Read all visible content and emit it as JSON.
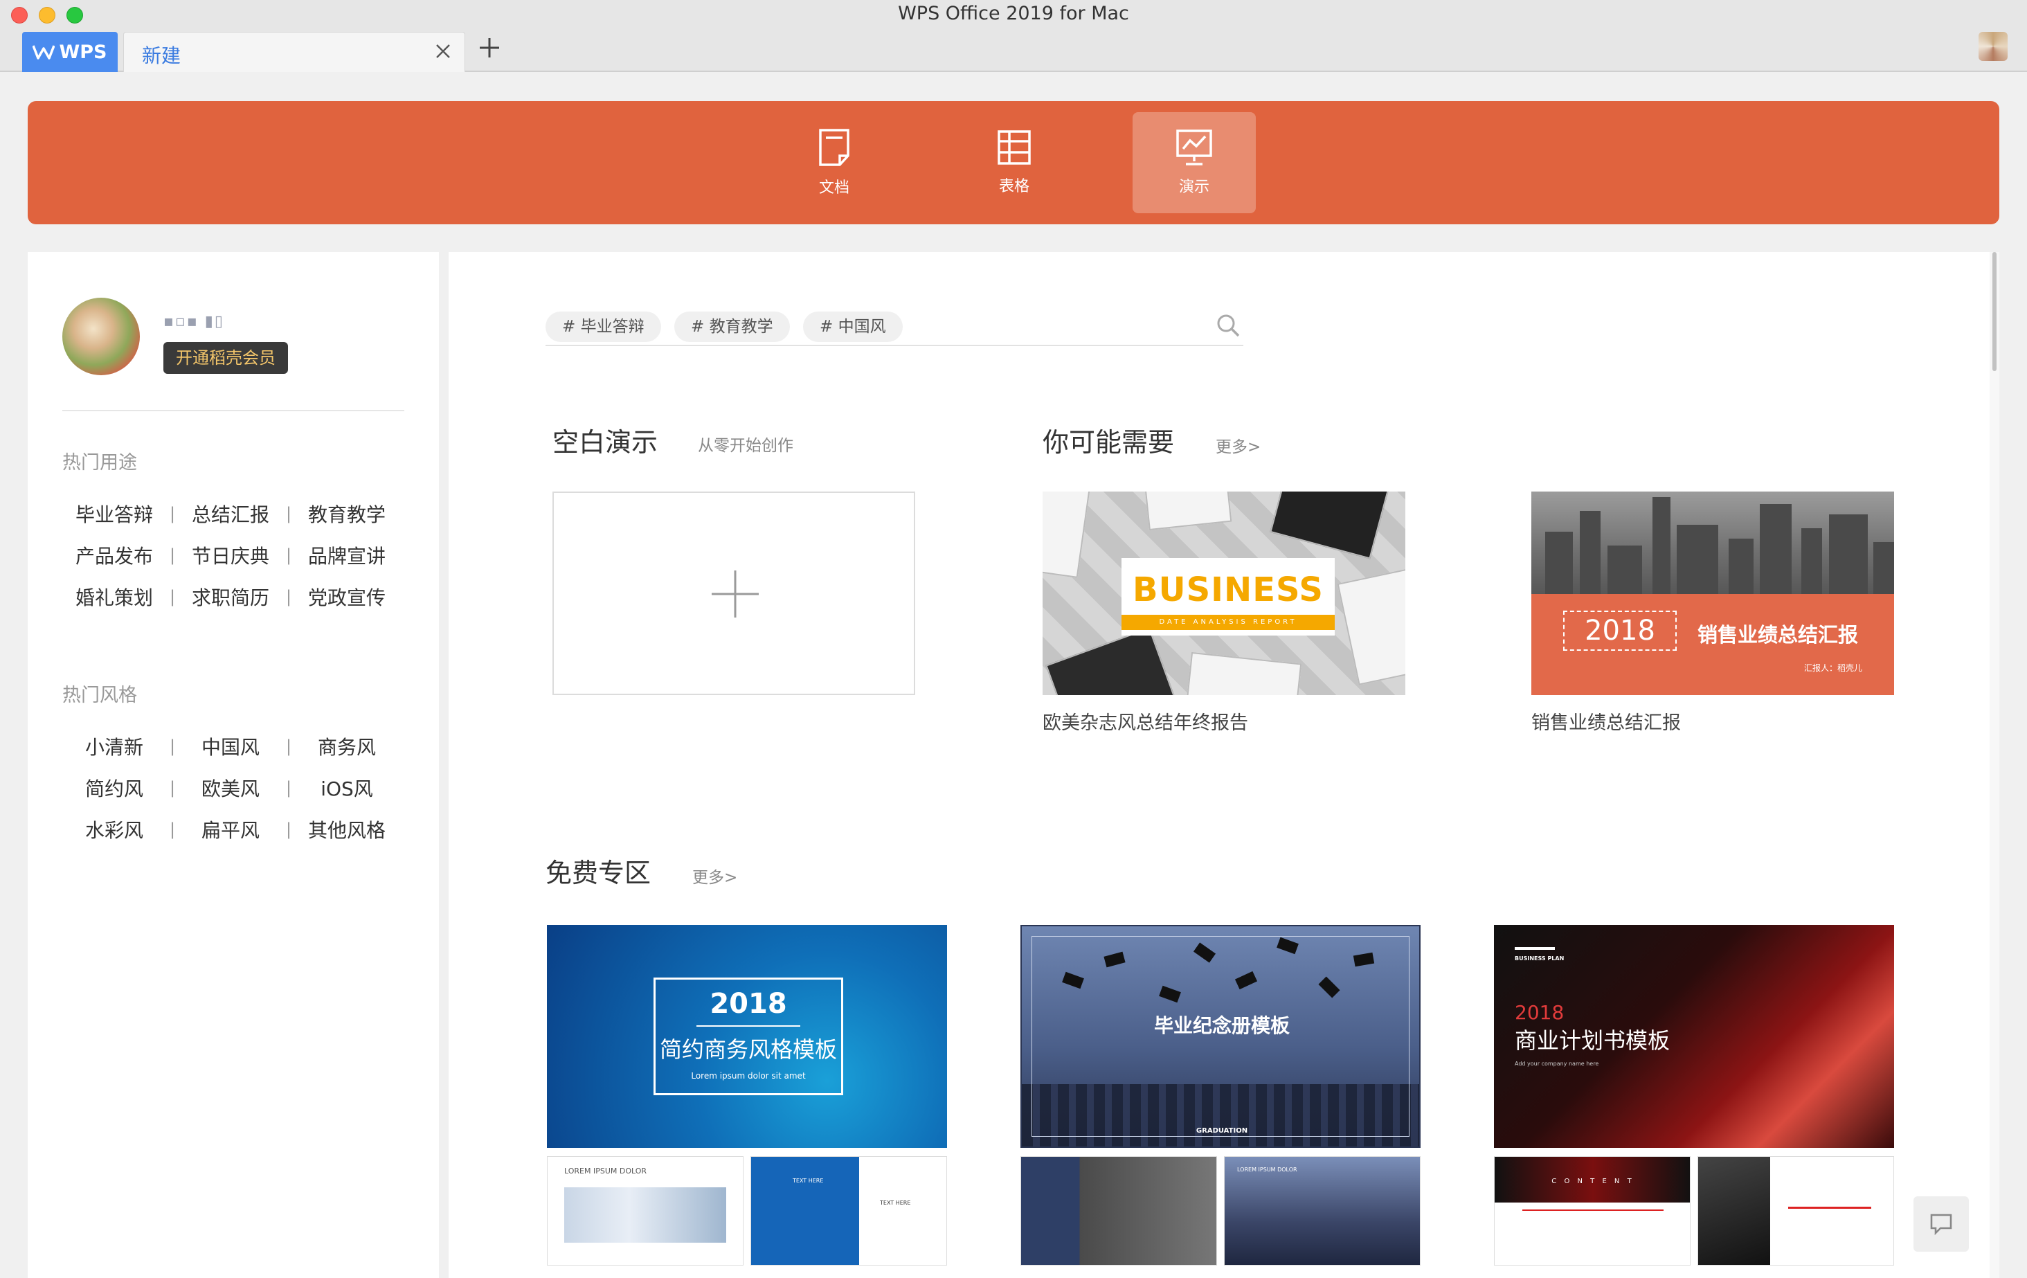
{
  "window": {
    "title": "WPS Office 2019 for Mac",
    "tabs": [
      {
        "label": "WPS"
      },
      {
        "label": "新建"
      }
    ]
  },
  "categories": [
    {
      "label": "文档",
      "icon": "document-icon"
    },
    {
      "label": "表格",
      "icon": "spreadsheet-icon"
    },
    {
      "label": "演示",
      "icon": "presentation-icon",
      "active": true
    }
  ],
  "sidebar": {
    "vip_button": "开通稻壳会员",
    "hot_uses": {
      "title": "热门用途",
      "rows": [
        [
          "毕业答辩",
          "总结汇报",
          "教育教学"
        ],
        [
          "产品发布",
          "节日庆典",
          "品牌宣讲"
        ],
        [
          "婚礼策划",
          "求职简历",
          "党政宣传"
        ]
      ]
    },
    "hot_styles": {
      "title": "热门风格",
      "rows": [
        [
          "小清新",
          "中国风",
          "商务风"
        ],
        [
          "简约风",
          "欧美风",
          "iOS风"
        ],
        [
          "水彩风",
          "扁平风",
          "其他风格"
        ]
      ]
    },
    "separator": "|"
  },
  "search": {
    "tags": [
      "# 毕业答辩",
      "# 教育教学",
      "# 中国风"
    ]
  },
  "blank_section": {
    "title": "空白演示",
    "subtitle": "从零开始创作"
  },
  "need_section": {
    "title": "你可能需要",
    "more": "更多>",
    "templates": [
      {
        "caption": "欧美杂志风总结年终报告",
        "cover_title": "BUSINESS",
        "cover_sub": "DATE ANALYSIS REPORT"
      },
      {
        "caption": "销售业绩总结汇报",
        "cover_year": "2018",
        "cover_title": "销售业绩总结汇报",
        "cover_reporter": "汇报人：稻壳儿"
      }
    ]
  },
  "free_section": {
    "title": "免费专区",
    "more": "更多>",
    "templates": [
      {
        "year": "2018",
        "name": "简约商务风格模板",
        "sub": "Lorem ipsum dolor sit amet",
        "thumb_a": "LOREM IPSUM DOLOR",
        "thumb_b": "TEXT HERE"
      },
      {
        "name": "毕业纪念册模板",
        "foot": "GRADUATION",
        "thumb_b": "LOREM IPSUM DOLOR"
      },
      {
        "tag": "BUSINESS PLAN",
        "year": "2018",
        "name": "商业计划书模板",
        "sub": "Add your company name here",
        "thumb_a": "C O N T E N T"
      }
    ]
  },
  "colors": {
    "accent": "#e0633e",
    "active_tab": "#4a8bef",
    "vip_text": "#f3c56a"
  }
}
